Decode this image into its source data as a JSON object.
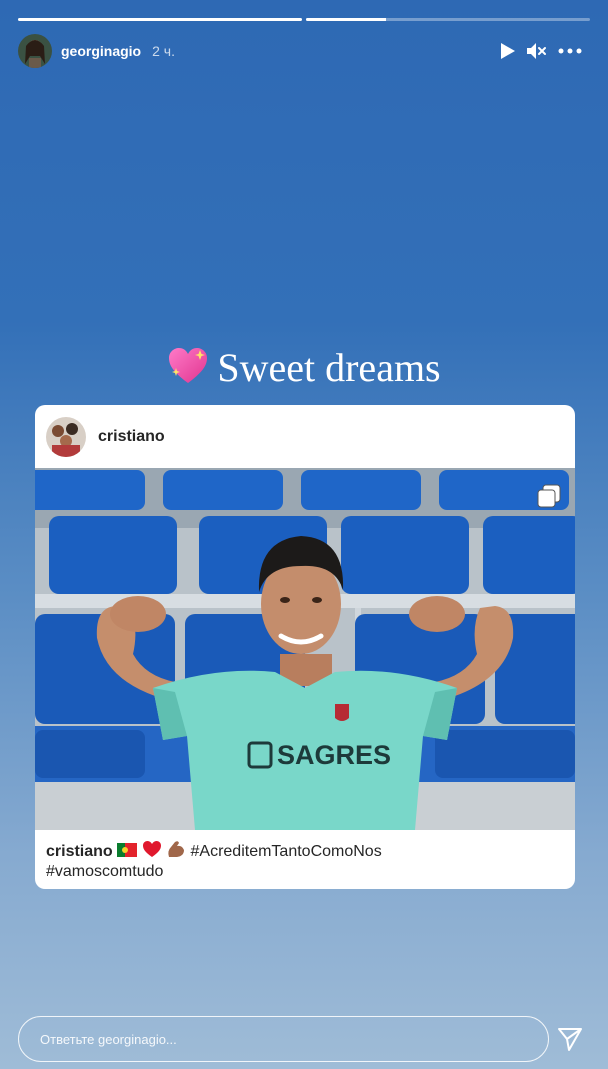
{
  "story": {
    "progress": [
      1.0,
      0.28
    ],
    "username": "georginagio",
    "time": "2 ч.",
    "controls": [
      "play-icon",
      "mute-icon",
      "more-icon"
    ]
  },
  "caption": {
    "emoji": "sparkling-heart-icon",
    "text": "Sweet dreams"
  },
  "shared_post": {
    "username": "cristiano",
    "multiple_icon": "carousel-icon",
    "photo_text": "SAGRES",
    "caption_user": "cristiano",
    "caption_emojis": [
      "portugal-flag-icon",
      "red-heart-icon",
      "flexed-biceps-icon"
    ],
    "hashtag1": "#AcreditemTantoComoNos",
    "hashtag2": "#vamoscomtudo"
  },
  "reply": {
    "placeholder": "Ответьте georginagio..."
  },
  "colors": {
    "background_top": "#2e69b4",
    "background_bottom": "#9fbcd7",
    "seat_blue": "#1f66c8",
    "jersey": "#79d7c9"
  }
}
